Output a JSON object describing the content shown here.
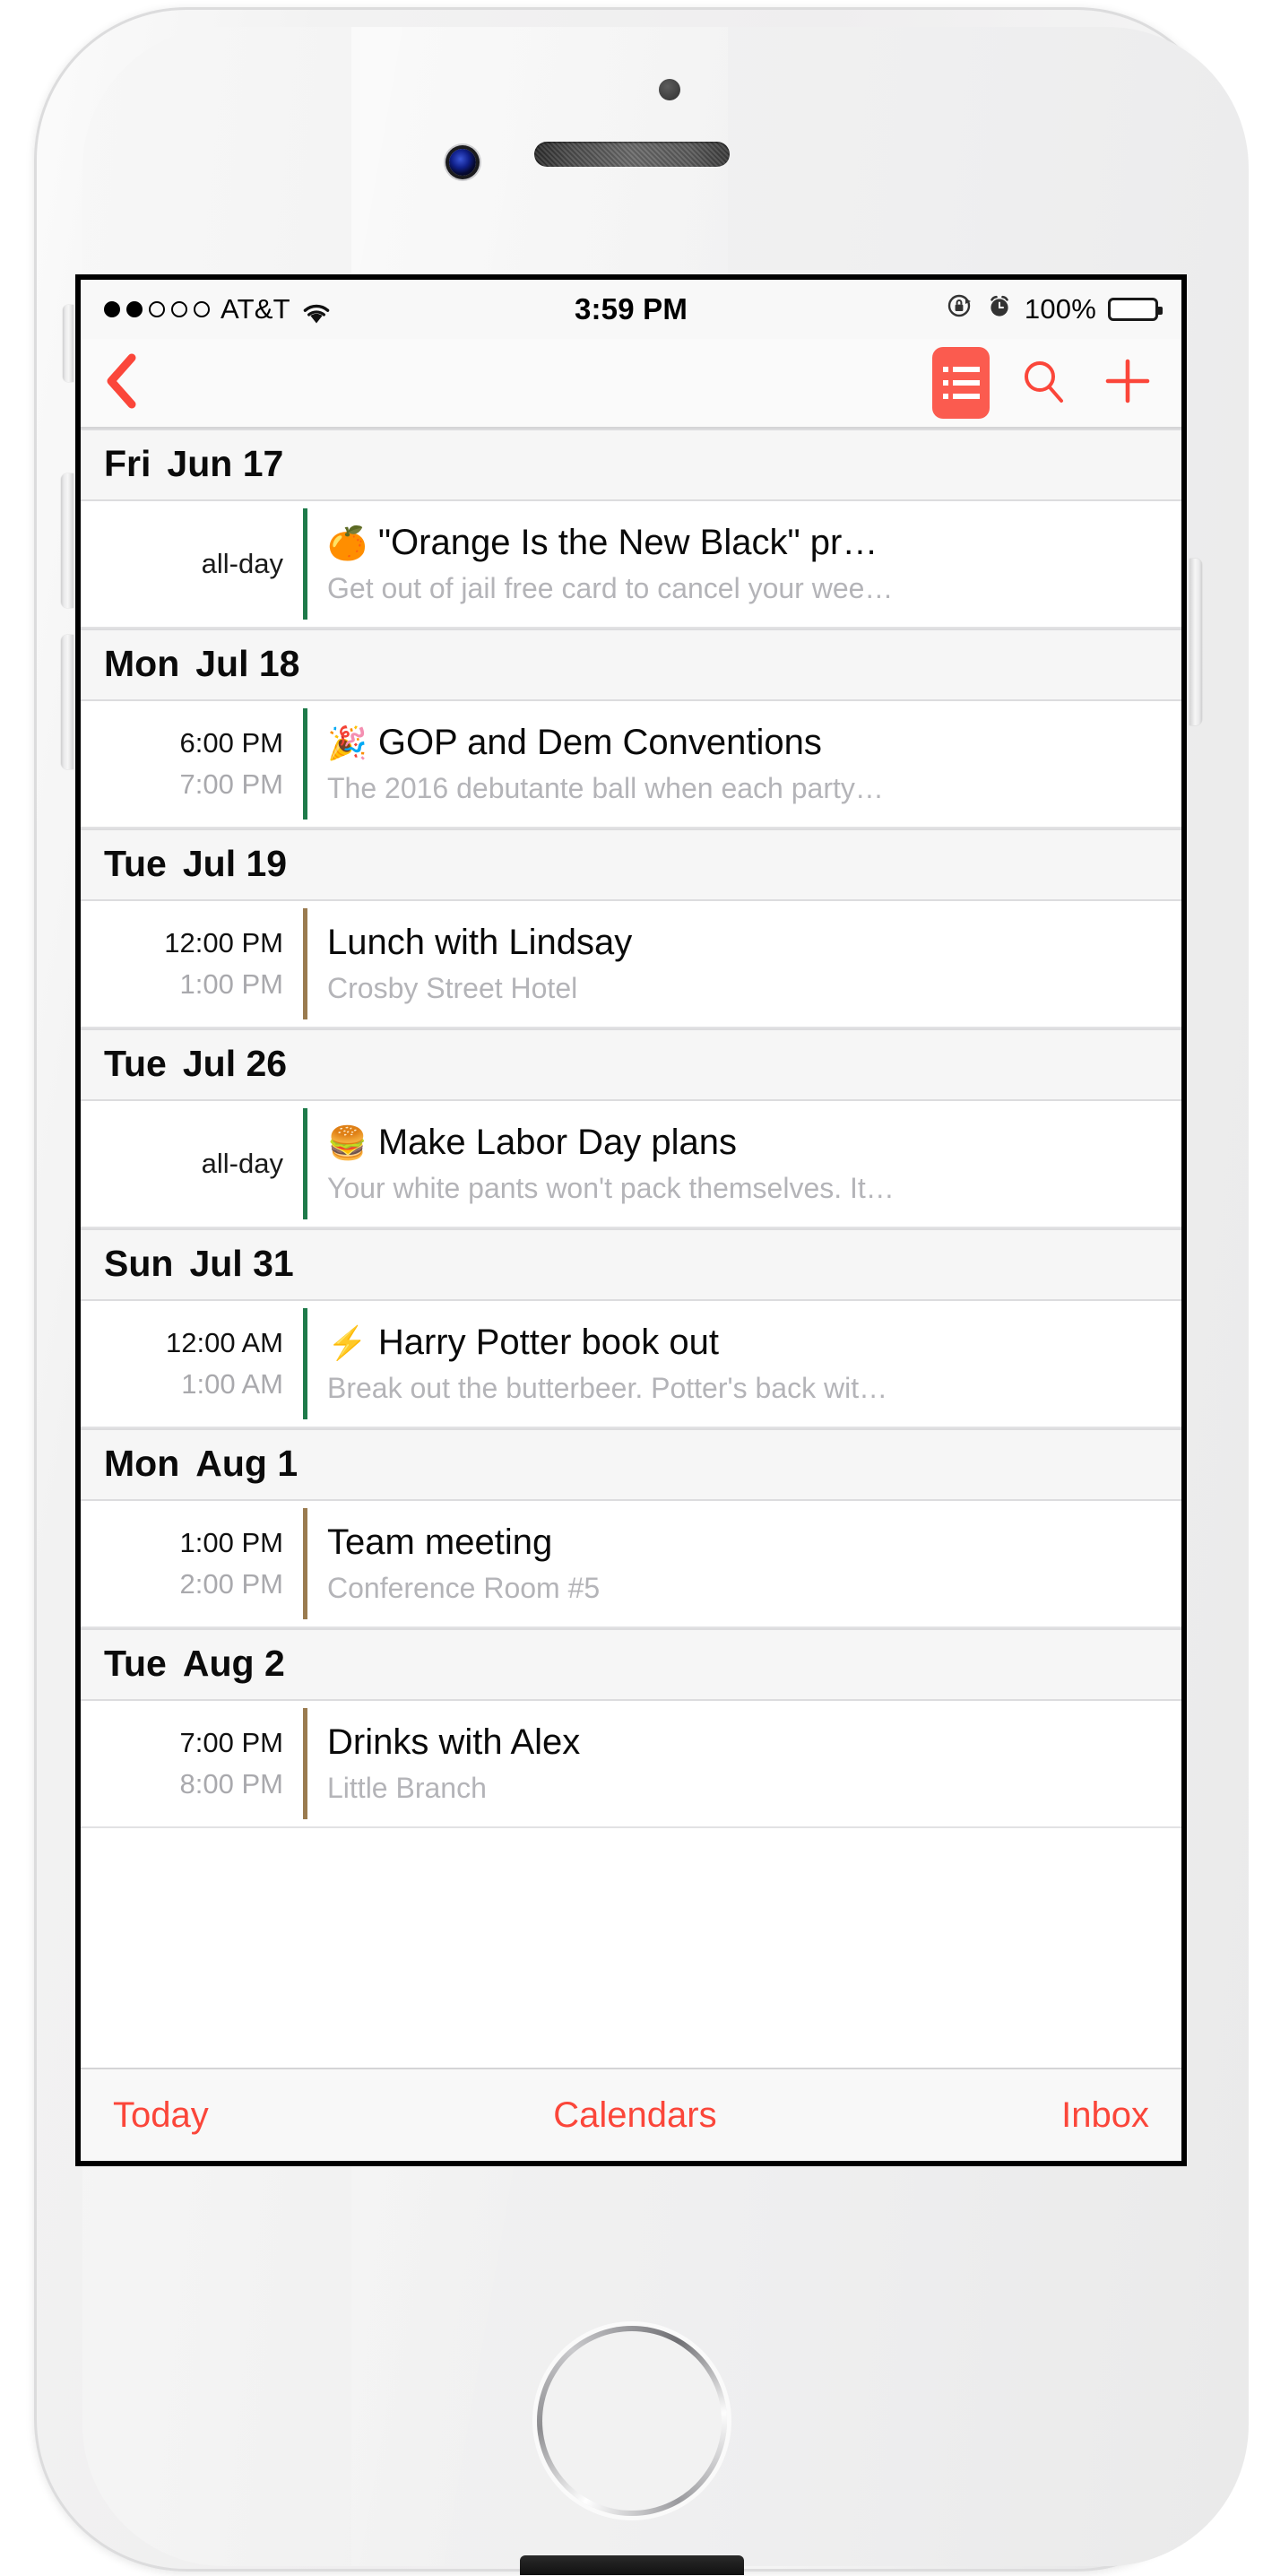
{
  "status_bar": {
    "signal_dots_filled": 2,
    "signal_dots_total": 5,
    "carrier": "AT&T",
    "wifi_icon": "wifi-icon",
    "time": "3:59 PM",
    "rotation_lock_icon": "rotation-lock-icon",
    "alarm_icon": "alarm-clock-icon",
    "battery_percent": "100%",
    "battery_level": 100
  },
  "nav_bar": {
    "back_icon": "chevron-left-icon",
    "list_view_icon": "list-view-icon",
    "search_icon": "search-icon",
    "add_icon": "plus-icon",
    "accent_color": "#fb5b4f"
  },
  "days": [
    {
      "dow": "Fri",
      "date": "Jun 17",
      "events": [
        {
          "start": "all-day",
          "end": "",
          "all_day": true,
          "emoji": "🍊",
          "emoji_name": "tangerine-emoji",
          "title": "\"Orange Is the New Black\" pr…",
          "subtitle": "Get out of jail free card to cancel your wee…",
          "calendar_color": "#1e7a4a"
        }
      ]
    },
    {
      "dow": "Mon",
      "date": "Jul 18",
      "events": [
        {
          "start": "6:00 PM",
          "end": "7:00 PM",
          "all_day": false,
          "emoji": "🎉",
          "emoji_name": "party-popper-emoji",
          "title": "GOP and Dem Conventions",
          "subtitle": "The 2016 debutante ball when each party…",
          "calendar_color": "#1e7a4a"
        }
      ]
    },
    {
      "dow": "Tue",
      "date": "Jul 19",
      "events": [
        {
          "start": "12:00 PM",
          "end": "1:00 PM",
          "all_day": false,
          "emoji": "",
          "emoji_name": "",
          "title": "Lunch with Lindsay",
          "subtitle": "Crosby Street Hotel",
          "calendar_color": "#9a7b4f"
        }
      ]
    },
    {
      "dow": "Tue",
      "date": "Jul 26",
      "events": [
        {
          "start": "all-day",
          "end": "",
          "all_day": true,
          "emoji": "🍔",
          "emoji_name": "hamburger-emoji",
          "title": "Make Labor Day plans",
          "subtitle": "Your white pants won't pack themselves. It…",
          "calendar_color": "#1e7a4a"
        }
      ]
    },
    {
      "dow": "Sun",
      "date": "Jul 31",
      "events": [
        {
          "start": "12:00 AM",
          "end": "1:00 AM",
          "all_day": false,
          "emoji": "⚡",
          "emoji_name": "high-voltage-emoji",
          "title": "Harry Potter book out",
          "subtitle": "Break out the butterbeer. Potter's back wit…",
          "calendar_color": "#1e7a4a"
        }
      ]
    },
    {
      "dow": "Mon",
      "date": "Aug 1",
      "events": [
        {
          "start": "1:00 PM",
          "end": "2:00 PM",
          "all_day": false,
          "emoji": "",
          "emoji_name": "",
          "title": "Team meeting",
          "subtitle": "Conference Room #5",
          "calendar_color": "#9a7b4f"
        }
      ]
    },
    {
      "dow": "Tue",
      "date": "Aug 2",
      "events": [
        {
          "start": "7:00 PM",
          "end": "8:00 PM",
          "all_day": false,
          "emoji": "",
          "emoji_name": "",
          "title": "Drinks with Alex",
          "subtitle": "Little Branch",
          "calendar_color": "#9a7b4f"
        }
      ]
    }
  ],
  "toolbar": {
    "today_label": "Today",
    "calendars_label": "Calendars",
    "inbox_label": "Inbox",
    "accent_color": "#fb463a"
  }
}
